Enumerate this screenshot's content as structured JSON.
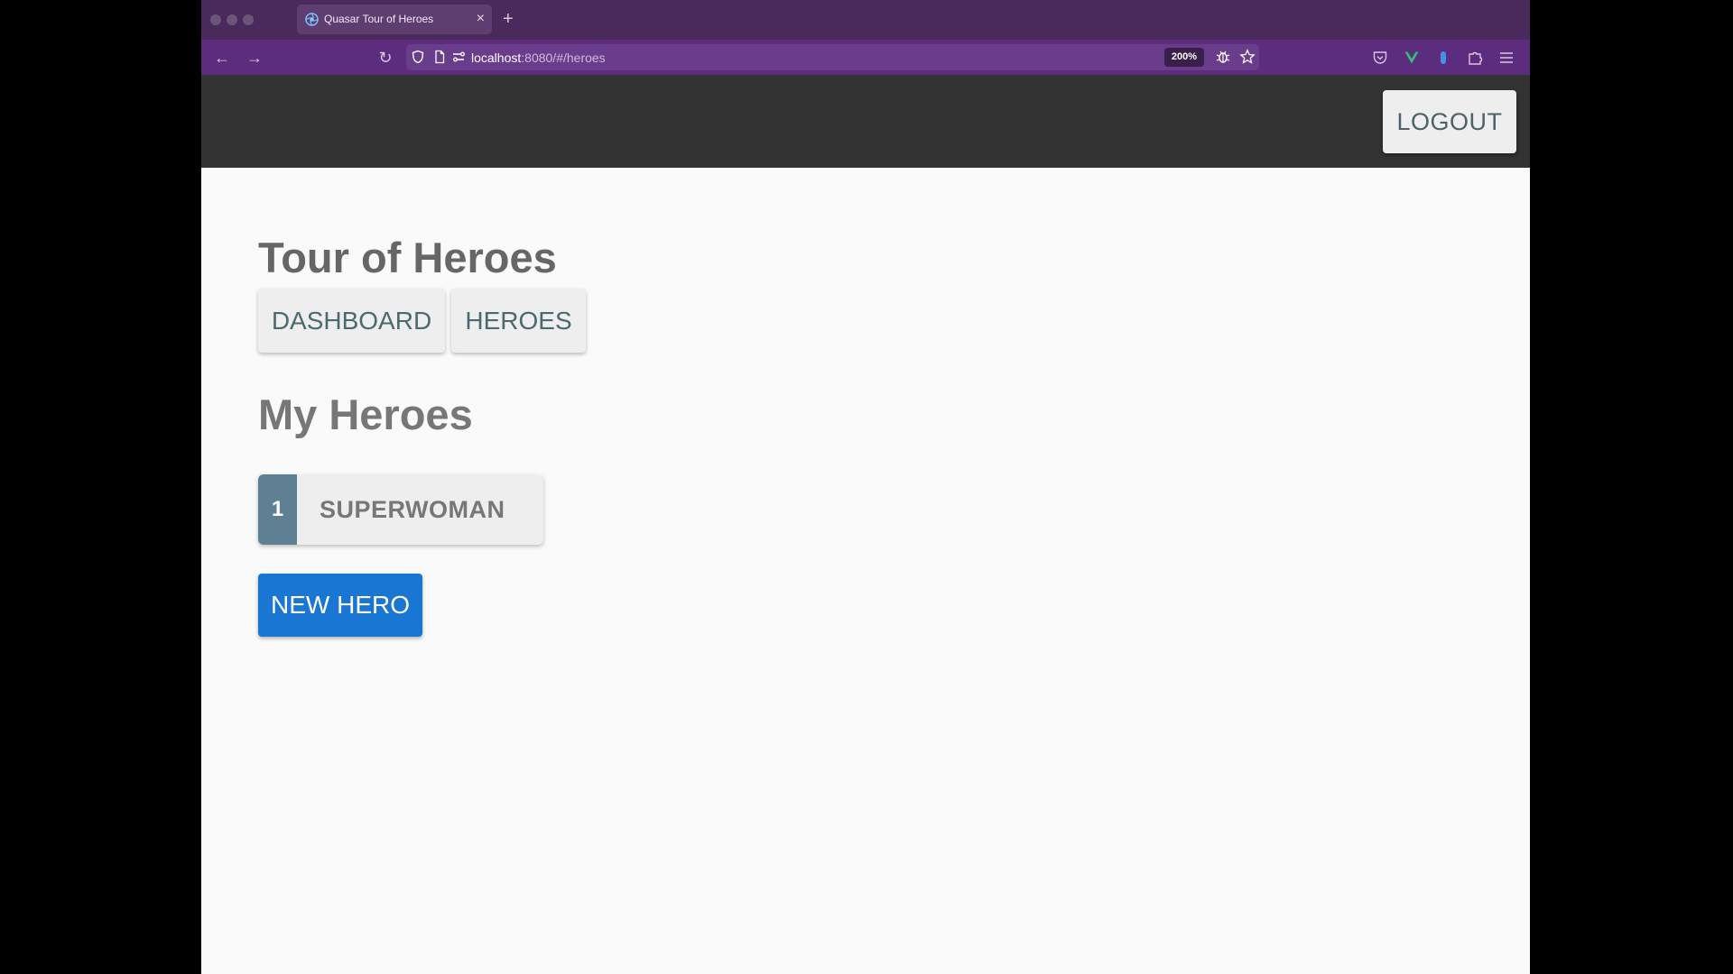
{
  "browser": {
    "tab_title": "Quasar Tour of Heroes",
    "tab_close": "×",
    "new_tab": "+",
    "url_host": "localhost",
    "url_path": ":8080/#/heroes",
    "zoom": "200%"
  },
  "header": {
    "logout_label": "LOGOUT"
  },
  "page": {
    "title": "Tour of Heroes",
    "nav": {
      "dashboard_label": "DASHBOARD",
      "heroes_label": "HEROES"
    },
    "section_title": "My Heroes",
    "heroes": [
      {
        "id": "1",
        "name": "SUPERWOMAN"
      }
    ],
    "new_hero_label": "NEW HERO"
  },
  "colors": {
    "browser_tabbar": "#4a2a5c",
    "browser_navbar": "#5c2d7e",
    "app_header": "#333333",
    "primary": "#1976d2",
    "hero_badge": "#5f7f93"
  }
}
